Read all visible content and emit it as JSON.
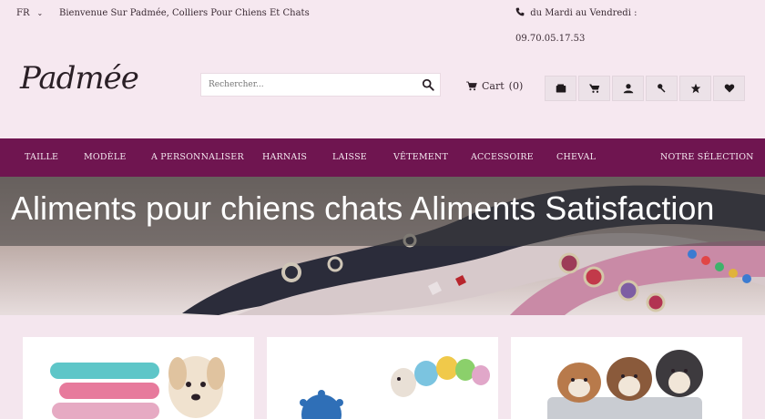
{
  "topbar": {
    "language": "FR",
    "welcome": "Bienvenue Sur Padmée, Colliers Pour Chiens Et Chats",
    "hours": "du Mardi au Vendredi :",
    "phone": "09.70.05.17.53"
  },
  "header": {
    "logo_text": "Padmée",
    "search_placeholder": "Rechercher...",
    "cart_label": "Cart",
    "cart_count": "(0)"
  },
  "icon_buttons": [
    "wallet-icon",
    "cart-icon",
    "user-icon",
    "key-icon",
    "star-icon",
    "heart-icon"
  ],
  "nav": {
    "items": [
      "TAILLE",
      "MODÈLE",
      "A PERSONNALISER",
      "HARNAIS",
      "LAISSE",
      "VÊTEMENT",
      "ACCESSOIRE",
      "CHEVAL",
      "NOTRE SÉLECTION"
    ]
  },
  "hero": {
    "title": "Aliments pour chiens chats Aliments Satisfaction"
  },
  "colors": {
    "nav_bg": "#6f1550",
    "page_bg": "#f6e8f0"
  }
}
